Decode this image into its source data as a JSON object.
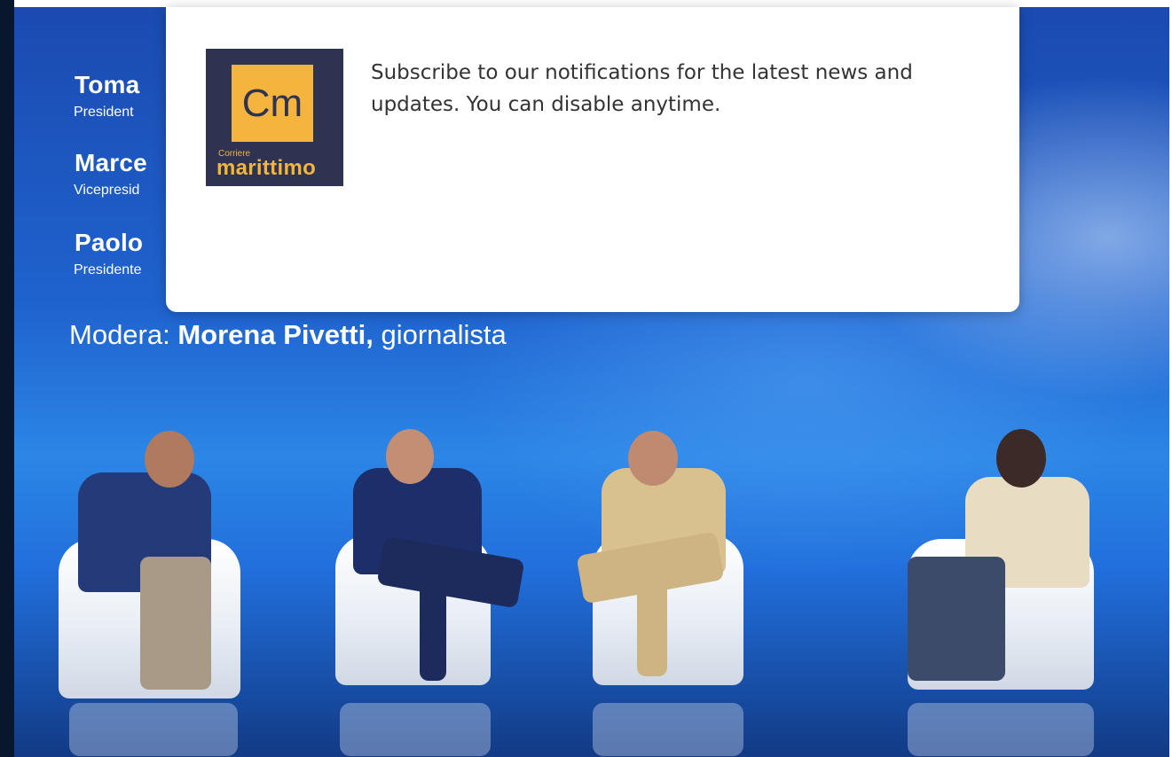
{
  "background_photo": {
    "speakers": [
      {
        "name": "Toma",
        "role": "President"
      },
      {
        "name": "Marce",
        "role": "Vicepresid"
      },
      {
        "name": "Paolo",
        "role": "Presidente"
      }
    ],
    "moderator": {
      "prefix": "Modera:",
      "name": "Morena Pivetti,",
      "suffix": "giornalista"
    }
  },
  "notification": {
    "logo": {
      "initials": "Cm",
      "small_text": "Corriere",
      "big_text": "marittimo",
      "bg_color": "#2e3352",
      "accent_color": "#f4b43e"
    },
    "message": "Subscribe to our notifications for the latest news and updates. You can disable anytime."
  }
}
